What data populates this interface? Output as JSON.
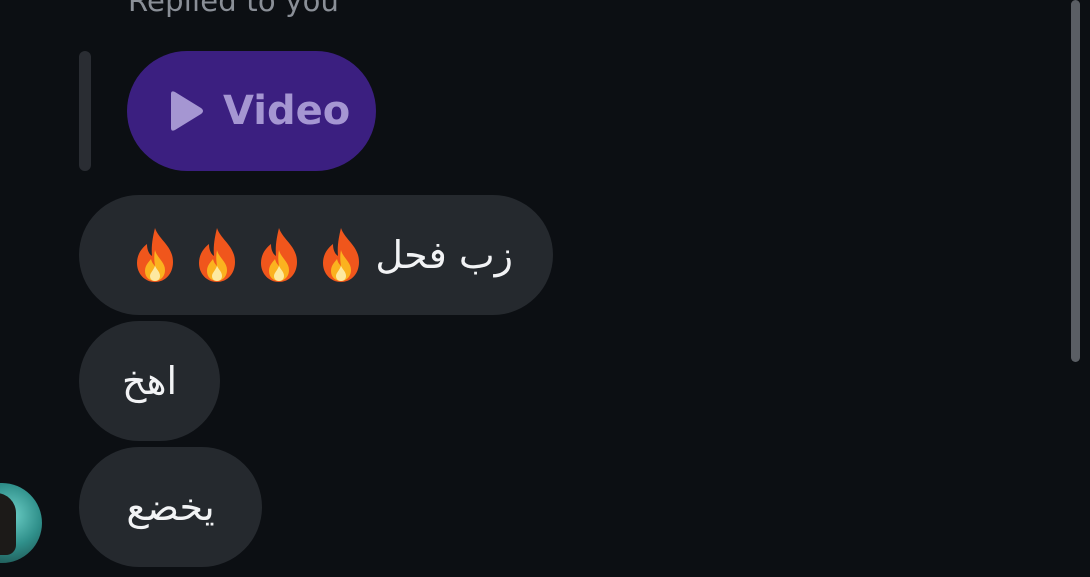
{
  "reply": {
    "caption": "Replied to you",
    "attachment_label": "Video",
    "attachment_icon": "play-icon"
  },
  "messages": [
    {
      "text": "زب فحل",
      "emoji": [
        "🔥",
        "🔥",
        "🔥",
        "🔥"
      ]
    },
    {
      "text": "اهخ"
    },
    {
      "text": "يخضع"
    }
  ],
  "colors": {
    "background": "#0c0f13",
    "bubble": "#25292e",
    "video_pill": "#3b1f80",
    "video_text": "#a596d2",
    "caption": "#8a8f97"
  }
}
